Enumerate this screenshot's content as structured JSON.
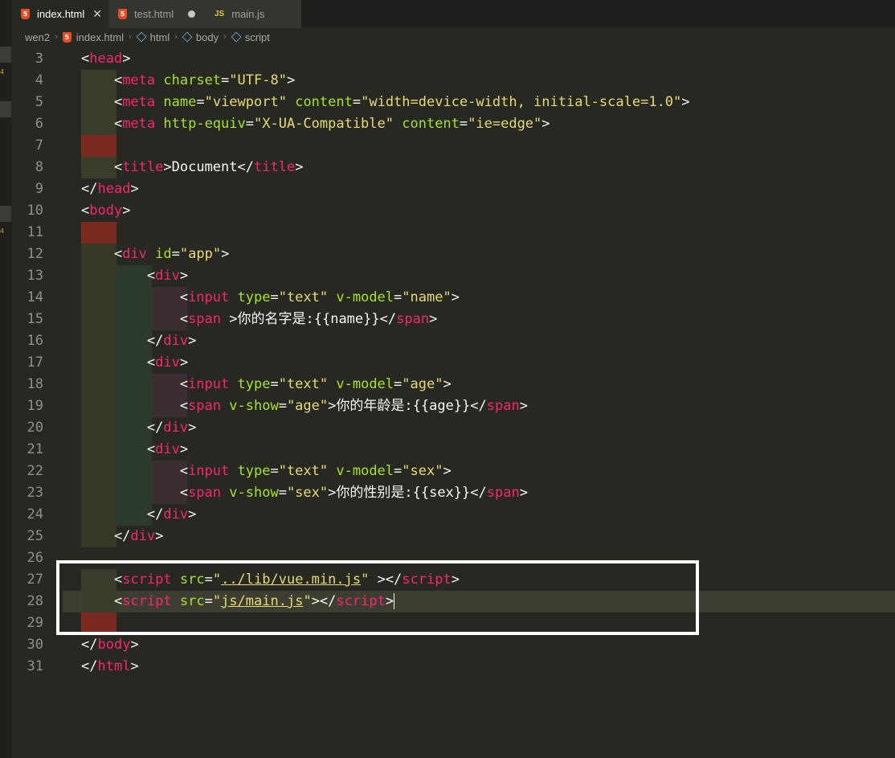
{
  "tabs": [
    {
      "label": "index.html",
      "icon": "html5-icon"
    },
    {
      "label": "test.html",
      "icon": "html5-icon"
    },
    {
      "label": "main.js",
      "icon": "js-icon",
      "icon_text": "JS"
    }
  ],
  "breadcrumb": [
    "wen2",
    "index.html",
    "html",
    "body",
    "script"
  ],
  "lines": [
    {
      "n": "3"
    },
    {
      "n": "4"
    },
    {
      "n": "5"
    },
    {
      "n": "6"
    },
    {
      "n": "7"
    },
    {
      "n": "8"
    },
    {
      "n": "9"
    },
    {
      "n": "10"
    },
    {
      "n": "11"
    },
    {
      "n": "12"
    },
    {
      "n": "13"
    },
    {
      "n": "14"
    },
    {
      "n": "15"
    },
    {
      "n": "16"
    },
    {
      "n": "17"
    },
    {
      "n": "18"
    },
    {
      "n": "19"
    },
    {
      "n": "20"
    },
    {
      "n": "21"
    },
    {
      "n": "22"
    },
    {
      "n": "23"
    },
    {
      "n": "24"
    },
    {
      "n": "25"
    },
    {
      "n": "26"
    },
    {
      "n": "27"
    },
    {
      "n": "28"
    },
    {
      "n": "29"
    },
    {
      "n": "30"
    },
    {
      "n": "31"
    }
  ],
  "code": {
    "title_text": "Document",
    "app_id": "app",
    "name_binding": "name",
    "name_text": "你的名字是:{{name}}",
    "age_binding": "age",
    "age_text": "你的年龄是:{{age}}",
    "sex_binding": "sex",
    "sex_text": "你的性别是:{{sex}}",
    "vue_src": "../lib/vue.min.js",
    "main_src": "js/main.js"
  },
  "colors": {
    "background": "#272822",
    "tag": "#f92672",
    "attribute": "#a6e22e",
    "string": "#e6db74",
    "text": "#f8f8f2"
  }
}
